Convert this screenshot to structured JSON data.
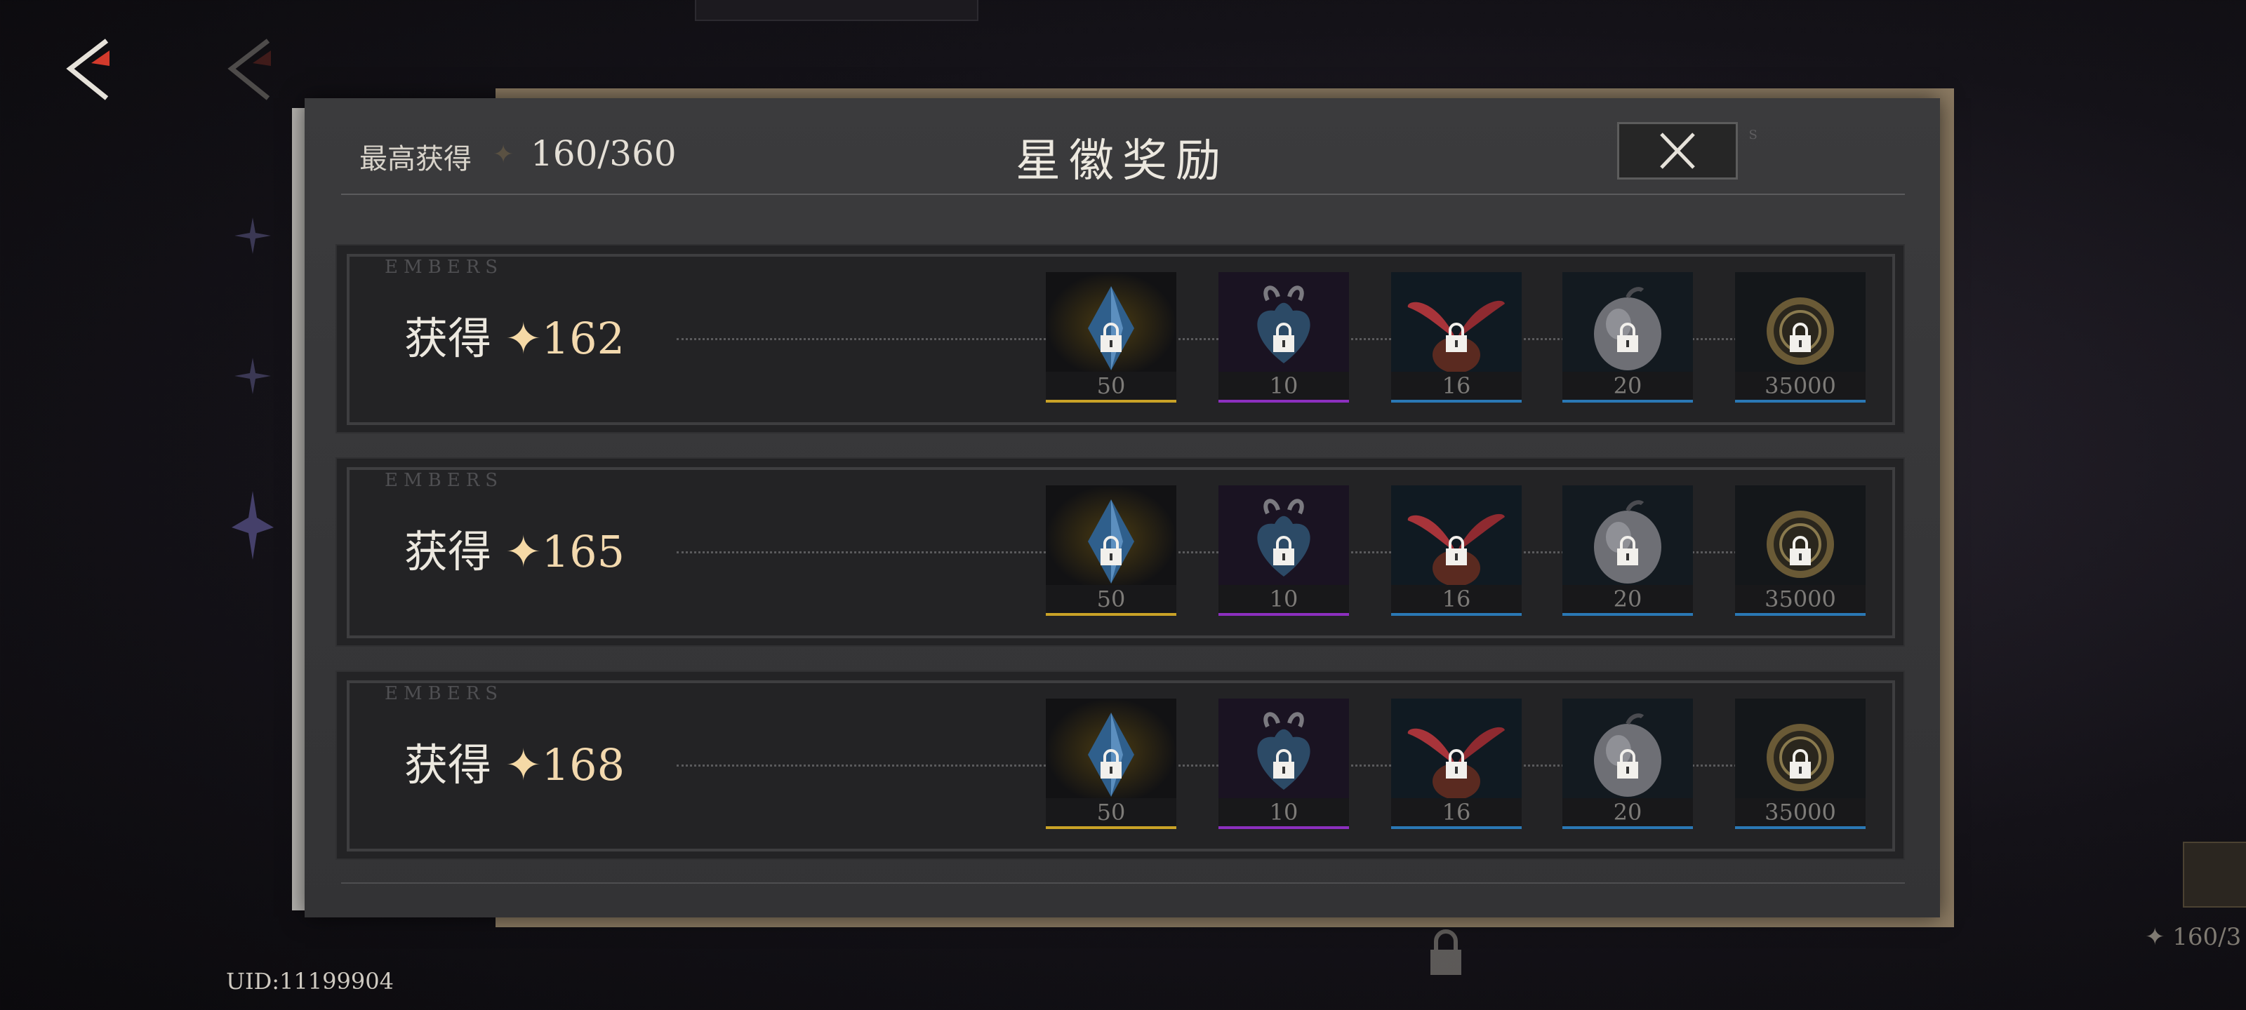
{
  "header": {
    "best_label": "最高获得",
    "best_value": "160/360",
    "title": "星徽奖励",
    "embers_watermark": "EMBERS"
  },
  "footer": {
    "uid": "UID:11199904",
    "side_count": "160/3"
  },
  "rows": [
    {
      "watermark": "EMBERS",
      "gain_label": "获得",
      "star": "✦",
      "threshold": "162",
      "items": [
        {
          "icon": "blue-crystal-icon",
          "qty": "50",
          "color": "#c9a227"
        },
        {
          "icon": "dark-heart-icon",
          "qty": "10",
          "color": "#8c2fbf"
        },
        {
          "icon": "red-sprout-icon",
          "qty": "16",
          "color": "#2a78b5"
        },
        {
          "icon": "grey-fruit-icon",
          "qty": "20",
          "color": "#2a78b5"
        },
        {
          "icon": "gold-coin-icon",
          "qty": "35000",
          "color": "#2a78b5"
        }
      ]
    },
    {
      "watermark": "EMBERS",
      "gain_label": "获得",
      "star": "✦",
      "threshold": "165",
      "items": [
        {
          "icon": "blue-crystal-icon",
          "qty": "50",
          "color": "#c9a227"
        },
        {
          "icon": "dark-heart-icon",
          "qty": "10",
          "color": "#8c2fbf"
        },
        {
          "icon": "red-sprout-icon",
          "qty": "16",
          "color": "#2a78b5"
        },
        {
          "icon": "grey-fruit-icon",
          "qty": "20",
          "color": "#2a78b5"
        },
        {
          "icon": "gold-coin-icon",
          "qty": "35000",
          "color": "#2a78b5"
        }
      ]
    },
    {
      "watermark": "EMBERS",
      "gain_label": "获得",
      "star": "✦",
      "threshold": "168",
      "items": [
        {
          "icon": "blue-crystal-icon",
          "qty": "50",
          "color": "#c9a227"
        },
        {
          "icon": "dark-heart-icon",
          "qty": "10",
          "color": "#8c2fbf"
        },
        {
          "icon": "red-sprout-icon",
          "qty": "16",
          "color": "#2a78b5"
        },
        {
          "icon": "grey-fruit-icon",
          "qty": "20",
          "color": "#2a78b5"
        },
        {
          "icon": "gold-coin-icon",
          "qty": "35000",
          "color": "#2a78b5"
        }
      ]
    }
  ]
}
